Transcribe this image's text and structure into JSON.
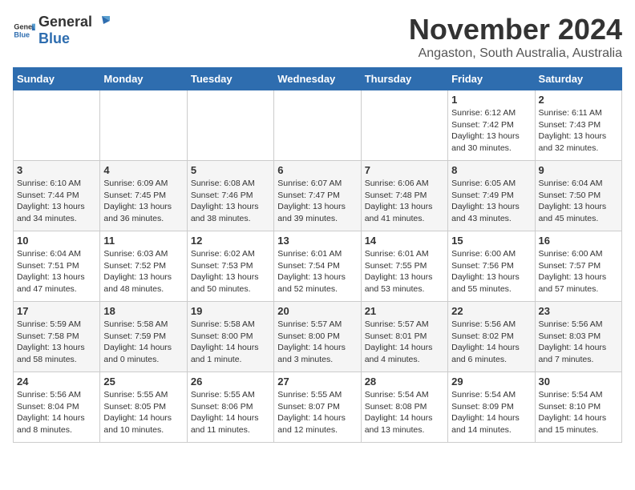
{
  "header": {
    "logo_general": "General",
    "logo_blue": "Blue",
    "month": "November 2024",
    "location": "Angaston, South Australia, Australia"
  },
  "days_of_week": [
    "Sunday",
    "Monday",
    "Tuesday",
    "Wednesday",
    "Thursday",
    "Friday",
    "Saturday"
  ],
  "weeks": [
    [
      {
        "day": "",
        "info": ""
      },
      {
        "day": "",
        "info": ""
      },
      {
        "day": "",
        "info": ""
      },
      {
        "day": "",
        "info": ""
      },
      {
        "day": "",
        "info": ""
      },
      {
        "day": "1",
        "info": "Sunrise: 6:12 AM\nSunset: 7:42 PM\nDaylight: 13 hours\nand 30 minutes."
      },
      {
        "day": "2",
        "info": "Sunrise: 6:11 AM\nSunset: 7:43 PM\nDaylight: 13 hours\nand 32 minutes."
      }
    ],
    [
      {
        "day": "3",
        "info": "Sunrise: 6:10 AM\nSunset: 7:44 PM\nDaylight: 13 hours\nand 34 minutes."
      },
      {
        "day": "4",
        "info": "Sunrise: 6:09 AM\nSunset: 7:45 PM\nDaylight: 13 hours\nand 36 minutes."
      },
      {
        "day": "5",
        "info": "Sunrise: 6:08 AM\nSunset: 7:46 PM\nDaylight: 13 hours\nand 38 minutes."
      },
      {
        "day": "6",
        "info": "Sunrise: 6:07 AM\nSunset: 7:47 PM\nDaylight: 13 hours\nand 39 minutes."
      },
      {
        "day": "7",
        "info": "Sunrise: 6:06 AM\nSunset: 7:48 PM\nDaylight: 13 hours\nand 41 minutes."
      },
      {
        "day": "8",
        "info": "Sunrise: 6:05 AM\nSunset: 7:49 PM\nDaylight: 13 hours\nand 43 minutes."
      },
      {
        "day": "9",
        "info": "Sunrise: 6:04 AM\nSunset: 7:50 PM\nDaylight: 13 hours\nand 45 minutes."
      }
    ],
    [
      {
        "day": "10",
        "info": "Sunrise: 6:04 AM\nSunset: 7:51 PM\nDaylight: 13 hours\nand 47 minutes."
      },
      {
        "day": "11",
        "info": "Sunrise: 6:03 AM\nSunset: 7:52 PM\nDaylight: 13 hours\nand 48 minutes."
      },
      {
        "day": "12",
        "info": "Sunrise: 6:02 AM\nSunset: 7:53 PM\nDaylight: 13 hours\nand 50 minutes."
      },
      {
        "day": "13",
        "info": "Sunrise: 6:01 AM\nSunset: 7:54 PM\nDaylight: 13 hours\nand 52 minutes."
      },
      {
        "day": "14",
        "info": "Sunrise: 6:01 AM\nSunset: 7:55 PM\nDaylight: 13 hours\nand 53 minutes."
      },
      {
        "day": "15",
        "info": "Sunrise: 6:00 AM\nSunset: 7:56 PM\nDaylight: 13 hours\nand 55 minutes."
      },
      {
        "day": "16",
        "info": "Sunrise: 6:00 AM\nSunset: 7:57 PM\nDaylight: 13 hours\nand 57 minutes."
      }
    ],
    [
      {
        "day": "17",
        "info": "Sunrise: 5:59 AM\nSunset: 7:58 PM\nDaylight: 13 hours\nand 58 minutes."
      },
      {
        "day": "18",
        "info": "Sunrise: 5:58 AM\nSunset: 7:59 PM\nDaylight: 14 hours\nand 0 minutes."
      },
      {
        "day": "19",
        "info": "Sunrise: 5:58 AM\nSunset: 8:00 PM\nDaylight: 14 hours\nand 1 minute."
      },
      {
        "day": "20",
        "info": "Sunrise: 5:57 AM\nSunset: 8:00 PM\nDaylight: 14 hours\nand 3 minutes."
      },
      {
        "day": "21",
        "info": "Sunrise: 5:57 AM\nSunset: 8:01 PM\nDaylight: 14 hours\nand 4 minutes."
      },
      {
        "day": "22",
        "info": "Sunrise: 5:56 AM\nSunset: 8:02 PM\nDaylight: 14 hours\nand 6 minutes."
      },
      {
        "day": "23",
        "info": "Sunrise: 5:56 AM\nSunset: 8:03 PM\nDaylight: 14 hours\nand 7 minutes."
      }
    ],
    [
      {
        "day": "24",
        "info": "Sunrise: 5:56 AM\nSunset: 8:04 PM\nDaylight: 14 hours\nand 8 minutes."
      },
      {
        "day": "25",
        "info": "Sunrise: 5:55 AM\nSunset: 8:05 PM\nDaylight: 14 hours\nand 10 minutes."
      },
      {
        "day": "26",
        "info": "Sunrise: 5:55 AM\nSunset: 8:06 PM\nDaylight: 14 hours\nand 11 minutes."
      },
      {
        "day": "27",
        "info": "Sunrise: 5:55 AM\nSunset: 8:07 PM\nDaylight: 14 hours\nand 12 minutes."
      },
      {
        "day": "28",
        "info": "Sunrise: 5:54 AM\nSunset: 8:08 PM\nDaylight: 14 hours\nand 13 minutes."
      },
      {
        "day": "29",
        "info": "Sunrise: 5:54 AM\nSunset: 8:09 PM\nDaylight: 14 hours\nand 14 minutes."
      },
      {
        "day": "30",
        "info": "Sunrise: 5:54 AM\nSunset: 8:10 PM\nDaylight: 14 hours\nand 15 minutes."
      }
    ]
  ]
}
